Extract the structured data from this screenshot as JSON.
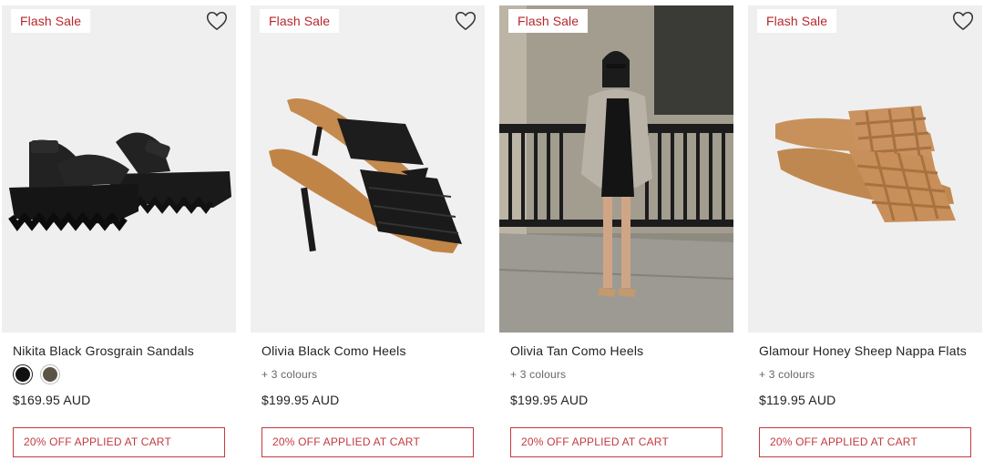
{
  "theme": {
    "accent": "#b5272d",
    "promo_border": "#c23a3f",
    "text": "#222222",
    "muted": "#666666"
  },
  "products": [
    {
      "badge": "Flash Sale",
      "name": "Nikita Black Grosgrain Sandals",
      "swatches": [
        {
          "color": "#111111",
          "selected": true
        },
        {
          "color": "#5b5446",
          "selected": false
        }
      ],
      "colours_text": "",
      "price": "$169.95 AUD",
      "promo": "20% OFF APPLIED AT CART",
      "image": "black-chunky-sandals",
      "wishlist_icon": "heart-outline-icon"
    },
    {
      "badge": "Flash Sale",
      "name": "Olivia Black Como Heels",
      "colours_text": "+ 3 colours",
      "price": "$199.95 AUD",
      "promo": "20% OFF APPLIED AT CART",
      "image": "black-woven-heeled-mules",
      "wishlist_icon": "heart-outline-icon"
    },
    {
      "badge": "Flash Sale",
      "name": "Olivia Tan Como Heels",
      "colours_text": "+ 3 colours",
      "price": "$199.95 AUD",
      "promo": "20% OFF APPLIED AT CART",
      "image": "model-street-photo",
      "wishlist_icon": ""
    },
    {
      "badge": "Flash Sale",
      "name": "Glamour Honey Sheep Nappa Flats",
      "colours_text": "+ 3 colours",
      "price": "$119.95 AUD",
      "promo": "20% OFF APPLIED AT CART",
      "image": "tan-woven-flat-slides",
      "wishlist_icon": "heart-outline-icon"
    }
  ]
}
